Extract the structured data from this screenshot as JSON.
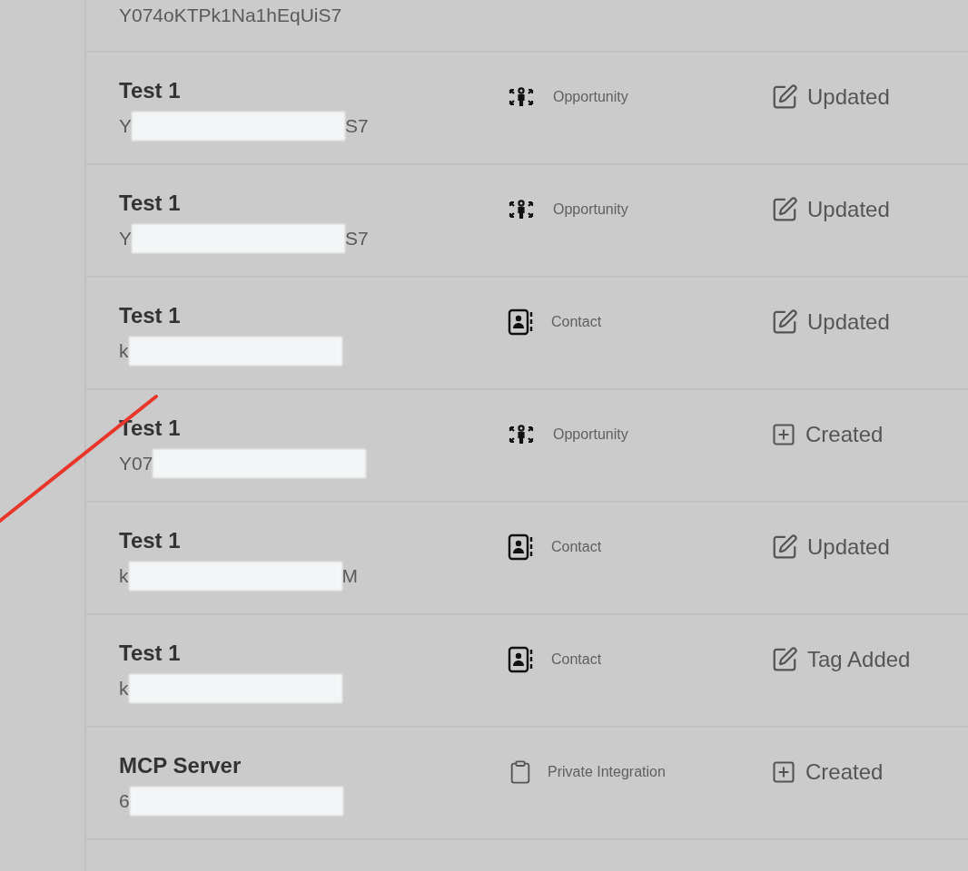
{
  "rows": [
    {
      "id": {
        "start": "Y074oKTPk1Na1hEqUiS7"
      }
    },
    {
      "name": "Test 1",
      "id": {
        "start": "Y",
        "end": "S7"
      },
      "type": {
        "kind": "opportunity",
        "label": "Opportunity"
      },
      "action": {
        "kind": "edit",
        "label": "Updated"
      }
    },
    {
      "name": "Test 1",
      "id": {
        "start": "Y",
        "end": "S7"
      },
      "type": {
        "kind": "opportunity",
        "label": "Opportunity"
      },
      "action": {
        "kind": "edit",
        "label": "Updated"
      }
    },
    {
      "name": "Test 1",
      "id": {
        "start": "k"
      },
      "type": {
        "kind": "contact",
        "label": "Contact"
      },
      "action": {
        "kind": "edit",
        "label": "Updated"
      }
    },
    {
      "name": "Test 1",
      "id": {
        "start": "Y07"
      },
      "type": {
        "kind": "opportunity",
        "label": "Opportunity"
      },
      "action": {
        "kind": "create",
        "label": "Created"
      }
    },
    {
      "name": "Test 1",
      "id": {
        "start": "k",
        "end": "M"
      },
      "type": {
        "kind": "contact",
        "label": "Contact"
      },
      "action": {
        "kind": "edit",
        "label": "Updated"
      }
    },
    {
      "name": "Test 1",
      "id": {
        "start": "k"
      },
      "type": {
        "kind": "contact",
        "label": "Contact"
      },
      "action": {
        "kind": "edit",
        "label": "Tag Added"
      }
    },
    {
      "name": "MCP Server",
      "id": {
        "start": "6"
      },
      "type": {
        "kind": "integration",
        "label": "Private Integration"
      },
      "action": {
        "kind": "create",
        "label": "Created"
      }
    }
  ]
}
